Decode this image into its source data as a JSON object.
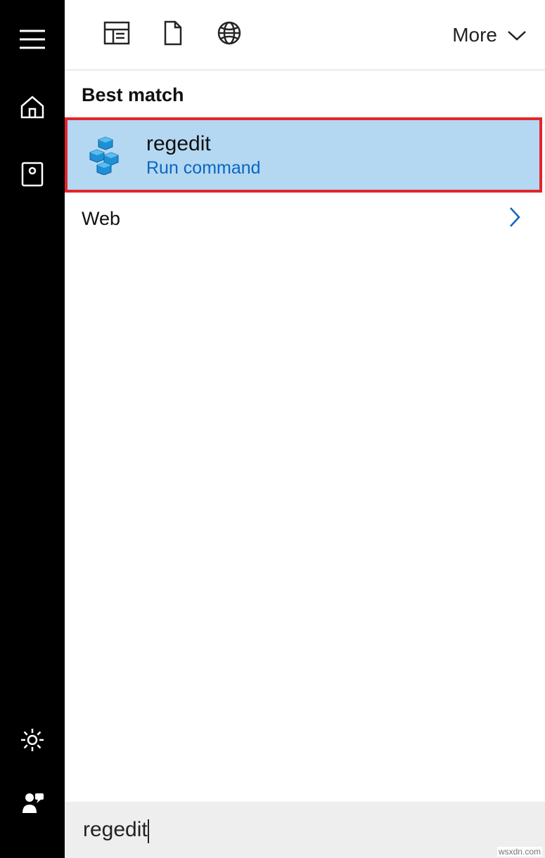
{
  "sidebar": {
    "top_items": [
      {
        "name": "hamburger-icon"
      },
      {
        "name": "home-icon"
      },
      {
        "name": "photos-icon"
      }
    ],
    "bottom_items": [
      {
        "name": "settings-gear-icon"
      },
      {
        "name": "user-feedback-icon"
      }
    ]
  },
  "filters": {
    "icons": [
      {
        "name": "apps-filter-icon"
      },
      {
        "name": "documents-filter-icon"
      },
      {
        "name": "web-filter-icon"
      }
    ],
    "more_label": "More"
  },
  "results": {
    "best_match_label": "Best match",
    "best_match": {
      "title": "regedit",
      "subtitle": "Run command",
      "icon": "registry-cubes-icon"
    },
    "web_label": "Web"
  },
  "search": {
    "value": "regedit"
  },
  "watermark": "wsxdn.com"
}
